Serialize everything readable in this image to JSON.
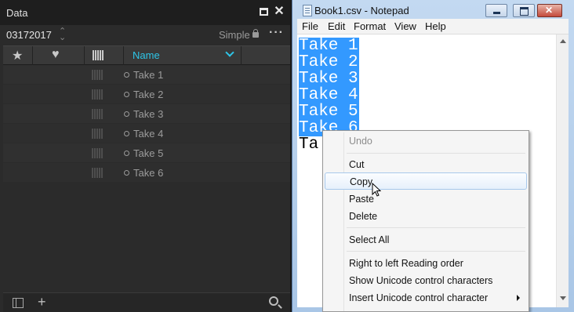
{
  "left_panel": {
    "title": "Data",
    "date": "03172017",
    "mode": "Simple",
    "columns": {
      "name": "Name"
    },
    "rows": [
      "Take 1",
      "Take 2",
      "Take 3",
      "Take 4",
      "Take 5",
      "Take 6"
    ]
  },
  "notepad": {
    "title": "Book1.csv - Notepad",
    "menu": [
      "File",
      "Edit",
      "Format",
      "View",
      "Help"
    ],
    "lines": [
      "Take 1",
      "Take 2",
      "Take 3",
      "Take 4",
      "Take 5",
      "Take 6",
      "Ta"
    ]
  },
  "context_menu": {
    "items": [
      {
        "label": "Undo",
        "enabled": false
      },
      {
        "label": "Cut",
        "enabled": true
      },
      {
        "label": "Copy",
        "enabled": true,
        "hover": true
      },
      {
        "label": "Paste",
        "enabled": true
      },
      {
        "label": "Delete",
        "enabled": true
      },
      {
        "label": "Select All",
        "enabled": true
      },
      {
        "label": "Right to left Reading order",
        "enabled": true
      },
      {
        "label": "Show Unicode control characters",
        "enabled": true
      },
      {
        "label": "Insert Unicode control character",
        "enabled": true,
        "submenu": true
      }
    ]
  },
  "colors": {
    "accent": "#2ec5e8",
    "selection": "#3399ff"
  }
}
